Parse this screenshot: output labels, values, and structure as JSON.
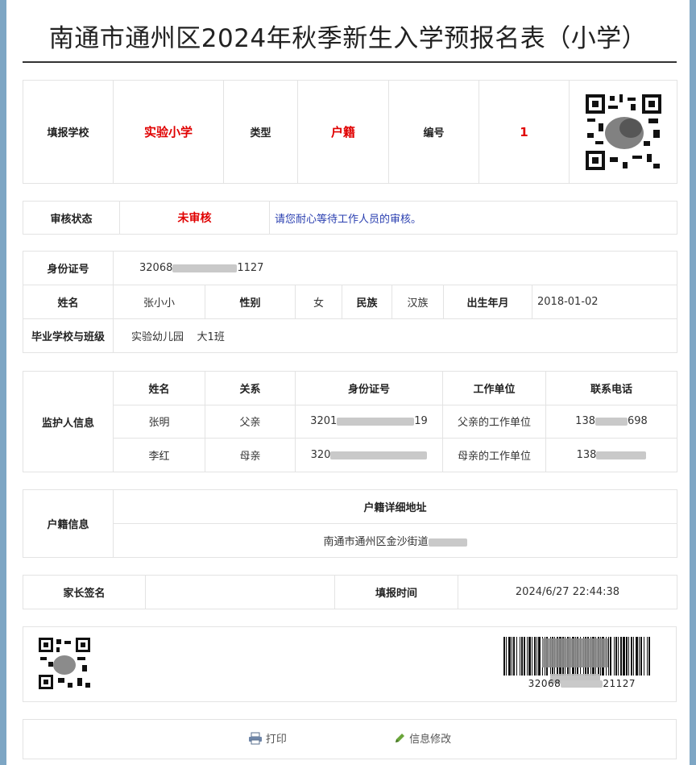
{
  "title": "南通市通州区2024年秋季新生入学预报名表（小学）",
  "school_row": {
    "school_label": "填报学校",
    "school_value": "实验小学",
    "type_label": "类型",
    "type_value": "户籍",
    "number_label": "编号",
    "number_value": "1"
  },
  "status_row": {
    "label": "审核状态",
    "value": "未审核",
    "message": "请您耐心等待工作人员的审核。"
  },
  "student": {
    "id_label": "身份证号",
    "id_prefix": "32068",
    "id_suffix": "1127",
    "name_label": "姓名",
    "name_value": "张小小",
    "gender_label": "性别",
    "gender_value": "女",
    "ethnic_label": "民族",
    "ethnic_value": "汉族",
    "birth_label": "出生年月",
    "birth_value": "2018-01-02",
    "school_label": "毕业学校与班级",
    "school_value": "实验幼儿园",
    "class_value": "大1班"
  },
  "guardian": {
    "section_label": "监护人信息",
    "headers": [
      "姓名",
      "关系",
      "身份证号",
      "工作单位",
      "联系电话"
    ],
    "rows": [
      {
        "name": "张明",
        "relation": "父亲",
        "id_prefix": "3201",
        "id_suffix": "19",
        "work": "父亲的工作单位",
        "phone_prefix": "138",
        "phone_suffix": "698"
      },
      {
        "name": "李红",
        "relation": "母亲",
        "id_prefix": "320",
        "id_suffix": "",
        "work": "母亲的工作单位",
        "phone_prefix": "138",
        "phone_suffix": ""
      }
    ]
  },
  "household": {
    "section_label": "户籍信息",
    "address_header": "户籍详细地址",
    "address_value": "南通市通州区金沙街道"
  },
  "signature_row": {
    "sign_label": "家长签名",
    "time_label": "填报时间",
    "time_value": "2024/6/27 22:44:38"
  },
  "barcode": {
    "text_prefix": "32068",
    "text_suffix": "21127"
  },
  "actions": {
    "print_label": "打印",
    "edit_label": "信息修改"
  },
  "colors": {
    "highlight_red": "#e00000",
    "message_blue": "#2a3fb0",
    "page_background": "#7ea6c4"
  }
}
